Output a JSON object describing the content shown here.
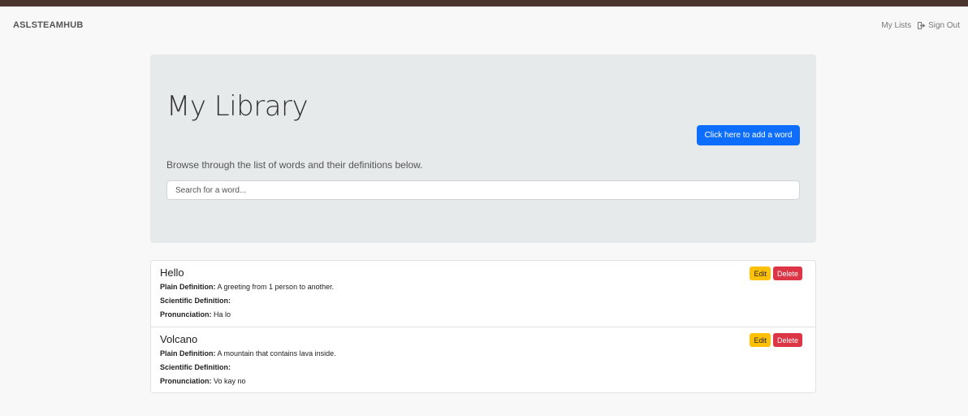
{
  "navbar": {
    "brand": "ASLSTEAMHUB",
    "my_lists": "My Lists",
    "sign_out": "Sign Out",
    "sign_out_icon": "sign-out-icon"
  },
  "library": {
    "title": "My Library",
    "add_button": "Click here to add a word",
    "lead": "Browse through the list of words and their definitions below.",
    "search_placeholder": "Search for a word..."
  },
  "labels": {
    "plain": "Plain Definition:",
    "scientific": "Scientific Definition:",
    "pronunciation": "Pronunciation:",
    "edit": "Edit",
    "delete": "Delete"
  },
  "words": [
    {
      "word": "Hello",
      "plain": "A greeting from 1 person to another.",
      "scientific": "",
      "pronunciation": "Ha lo"
    },
    {
      "word": "Volcano",
      "plain": "A mountain that contains lava inside.",
      "scientific": "",
      "pronunciation": "Vo kay no"
    }
  ],
  "colors": {
    "top_border": "#4a362f",
    "primary": "#0d6efd",
    "warning": "#ffc107",
    "danger": "#dc3545"
  }
}
